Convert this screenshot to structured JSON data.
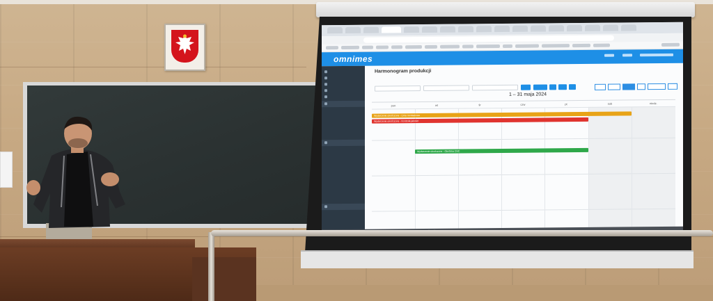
{
  "scene": {
    "colors": {
      "wall": "#c7a983",
      "blackboard": "#2c3434",
      "emblem_red": "#d4141c",
      "desk": "#5e3520",
      "app_blue": "#1e8fe6",
      "sidebar": "#2c3945"
    }
  },
  "projected_app": {
    "logo": "omnimes",
    "page_title": "Harmonogram produkcji",
    "date_range": "1 – 31 maja 2024",
    "weekdays": [
      "pon",
      "wt",
      "śr",
      "czw",
      "pt",
      "sob",
      "niedz."
    ],
    "events": [
      {
        "label": "Wydarzenie ukończone - Linia montażowa",
        "color": "#e8a317"
      },
      {
        "label": "Wydarzenie ukończone - Kontrola jakości",
        "color": "#e0342f"
      },
      {
        "label": "Wydarzenie ukończone - Obróbka CNC",
        "color": "#2fa84a"
      }
    ]
  }
}
